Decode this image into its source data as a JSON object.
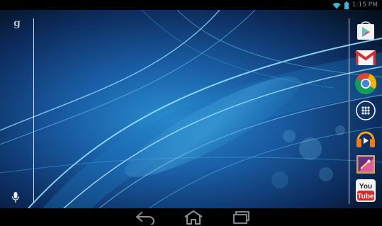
{
  "status_bar": {
    "time": "1:15 PM",
    "icons": [
      "wifi-icon",
      "battery-icon"
    ]
  },
  "home": {
    "search_logo": "g",
    "search_icons": [
      "google-search-icon",
      "voice-search-icon"
    ]
  },
  "dock": {
    "apps": [
      {
        "icon": "play-store-icon"
      },
      {
        "icon": "gmail-icon"
      },
      {
        "icon": "chrome-icon"
      },
      {
        "icon": "all-apps-icon"
      },
      {
        "icon": "play-music-icon"
      },
      {
        "icon": "gallery-icon"
      },
      {
        "icon": "youtube-icon",
        "text_top": "You",
        "text_bottom": "Tube"
      }
    ]
  },
  "nav_bar": {
    "buttons": [
      "back-icon",
      "home-icon",
      "recent-apps-icon"
    ]
  },
  "colors": {
    "wallpaper_dark": "#07162c",
    "wallpaper_light": "#38b8e8",
    "wifi": "#33b5e5",
    "nav_icon": "#8a8f96"
  }
}
